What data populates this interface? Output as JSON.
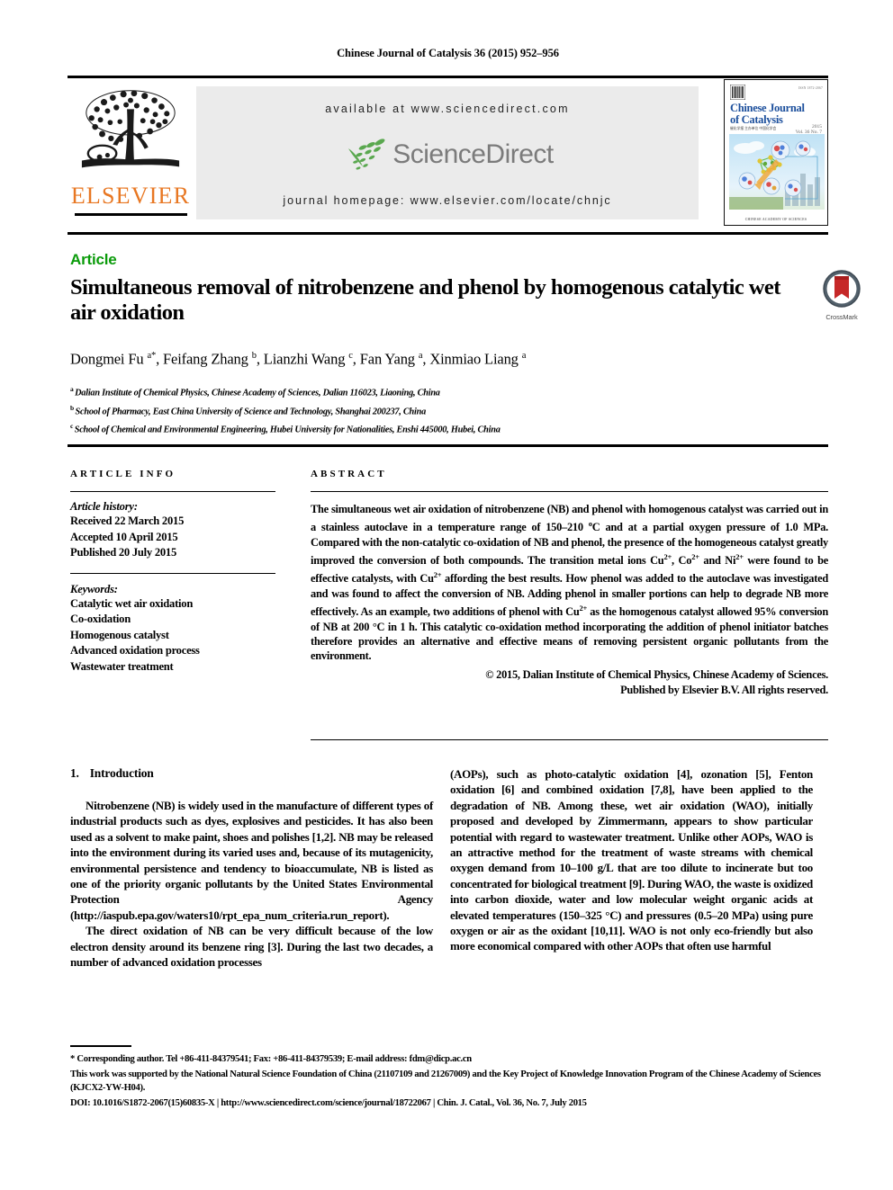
{
  "running_head": "Chinese Journal of Catalysis 36 (2015) 952–956",
  "masthead": {
    "publisher_name": "ELSEVIER",
    "available_at": "available at www.sciencedirect.com",
    "sciencedirect_word": "ScienceDirect",
    "journal_homepage": "journal homepage: www.elsevier.com/locate/chnjc",
    "cover": {
      "title_line1": "Chinese Journal",
      "title_line2": "of Catalysis",
      "subtitle": "催化学报 主办单位 中国化学会",
      "year": "2015",
      "issue": "Vol. 36 No. 7",
      "top_right": "ISSN 1872-2067",
      "footer": "CHINESE ACADEMY OF SCIENCES"
    }
  },
  "article": {
    "type_label": "Article",
    "title": "Simultaneous removal of nitrobenzene and phenol by homogenous catalytic wet air oxidation",
    "authors": [
      {
        "name": "Dongmei Fu",
        "sup": "a",
        "star": "*"
      },
      {
        "name": "Feifang Zhang",
        "sup": "b",
        "star": ""
      },
      {
        "name": "Lianzhi Wang",
        "sup": "c",
        "star": ""
      },
      {
        "name": "Fan Yang",
        "sup": "a",
        "star": ""
      },
      {
        "name": "Xinmiao Liang",
        "sup": "a",
        "star": ""
      }
    ],
    "affiliations": [
      {
        "marker": "a",
        "text": "Dalian Institute of Chemical Physics, Chinese Academy of Sciences, Dalian 116023, Liaoning, China"
      },
      {
        "marker": "b",
        "text": "School of Pharmacy, East China University of Science and Technology, Shanghai 200237, China"
      },
      {
        "marker": "c",
        "text": "School of Chemical and Environmental Engineering, Hubei University for Nationalities, Enshi 445000, Hubei, China"
      }
    ],
    "crossmark_label": "CrossMark"
  },
  "article_info": {
    "heading": "ARTICLE INFO",
    "history_label": "Article history:",
    "history": [
      "Received 22 March 2015",
      "Accepted 10 April 2015",
      "Published 20 July 2015"
    ],
    "keywords_label": "Keywords:",
    "keywords": [
      "Catalytic wet air oxidation",
      "Co-oxidation",
      "Homogenous catalyst",
      "Advanced oxidation process",
      "Wastewater treatment"
    ]
  },
  "abstract": {
    "heading": "ABSTRACT",
    "paragraph_part1": "The simultaneous wet air oxidation of nitrobenzene (NB) and phenol with homogenous catalyst was carried out in a stainless autoclave in a temperature range of 150–210 ",
    "temp_unit_1": "o",
    "paragraph_part2": "C and at a partial oxygen pressure of 1.0 MPa. Compared with the non-catalytic co-oxidation of NB and phenol, the presence of the homogeneous catalyst greatly improved the conversion of both compounds. The transition metal ions Cu",
    "sup_cu1": "2+",
    "paragraph_part3": ", Co",
    "sup_co": "2+",
    "paragraph_part4": " and Ni",
    "sup_ni": "2+",
    "paragraph_part5": " were found to be effective catalysts, with Cu",
    "sup_cu2": "2+",
    "paragraph_part6": " affording the best results. How phenol was added to the autoclave was investigated and was found to affect the conversion of NB. Adding phenol in smaller portions can help to degrade NB more effectively. As an example, two additions of phenol with Cu",
    "sup_cu3": "2+",
    "paragraph_part7": " as the homogenous catalyst allowed 95% conversion of NB at 200 °C in 1 h. This catalytic co-oxidation method incorporating the addition of phenol initiator batches therefore provides an alternative and effective means of removing persistent organic pollutants from the environment.",
    "copyright_line1": "© 2015, Dalian Institute of Chemical Physics, Chinese Academy of Sciences.",
    "copyright_line2": "Published by Elsevier B.V. All rights reserved."
  },
  "introduction": {
    "number": "1.",
    "heading": "Introduction",
    "left_paragraphs": [
      "Nitrobenzene (NB) is widely used in the manufacture of different types of industrial products such as dyes, explosives and pesticides. It has also been used as a solvent to make paint, shoes and polishes [1,2]. NB may be released into the environment during its varied uses and, because of its mutagenicity, environmental persistence and tendency to bioaccumulate, NB is listed as one of the priority organic pollutants by the United States Environmental Protection Agency (http://iaspub.epa.gov/waters10/rpt_epa_num_criteria.run_report).",
      "The direct oxidation of NB can be very difficult because of the low electron density around its benzene ring [3]. During the last two decades, a number of advanced oxidation processes"
    ],
    "right_paragraphs": [
      "(AOPs), such as photo-catalytic oxidation [4], ozonation [5], Fenton oxidation [6] and combined oxidation [7,8], have been applied to the degradation of NB. Among these, wet air oxidation (WAO), initially proposed and developed by Zimmermann, appears to show particular potential with regard to wastewater treatment. Unlike other AOPs, WAO is an attractive method for the treatment of waste streams with chemical oxygen demand from 10–100 g/L that are too dilute to incinerate but too concentrated for biological treatment [9]. During WAO, the waste is oxidized into carbon dioxide, water and low molecular weight organic acids at elevated temperatures (150–325 °C) and pressures (0.5–20 MPa) using pure oxygen or air as the oxidant [10,11]. WAO is not only eco-friendly but also more economical compared with other AOPs that often use harmful"
    ]
  },
  "footnotes": {
    "corresponding": "* Corresponding author. Tel +86-411-84379541; Fax: +86-411-84379539; E-mail address: fdm@dicp.ac.cn",
    "funding": "This work was supported by the National Natural Science Foundation of China (21107109 and 21267009) and the Key Project of Knowledge Innovation Program of the Chinese Academy of Sciences (KJCX2-YW-H04).",
    "doi_line": "DOI: 10.1016/S1872-2067(15)60835-X | http://www.sciencedirect.com/science/journal/18722067 | Chin. J. Catal., Vol. 36, No. 7, July 2015"
  },
  "colors": {
    "elsevier_orange": "#E87722",
    "sciencedirect_green": "#5aa84f",
    "sciencedirect_gray": "#7b7b7b",
    "article_label_green": "#0a9b0a",
    "cover_blue": "#1c4f9c",
    "crossmark_red": "#c62828",
    "banner_gray": "#ebebeb"
  }
}
